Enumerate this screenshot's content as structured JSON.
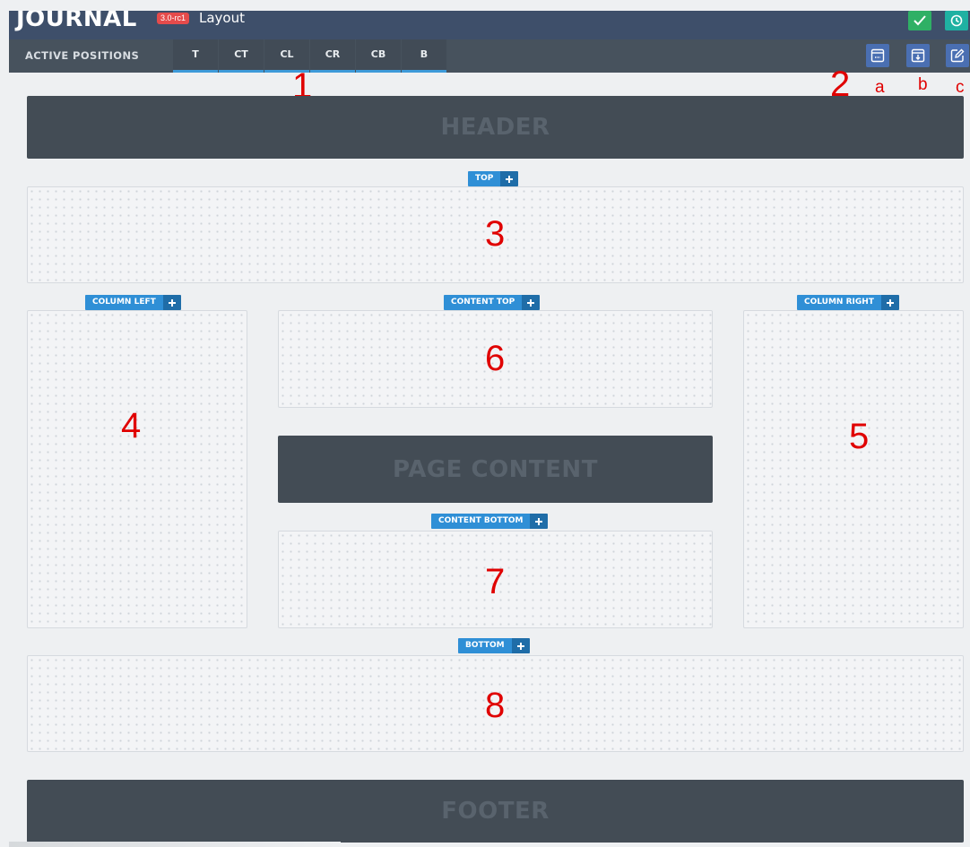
{
  "app": {
    "logo": "JOURNAL",
    "version": "3.0-rc1",
    "page_title": "Layout"
  },
  "top_buttons": [
    {
      "name": "save",
      "icon": "check-icon"
    },
    {
      "name": "history",
      "icon": "history-icon"
    }
  ],
  "positions_bar": {
    "label": "ACTIVE POSITIONS",
    "tabs": [
      "T",
      "CT",
      "CL",
      "CR",
      "CB",
      "B"
    ]
  },
  "tools": [
    {
      "icon": "layout-icon"
    },
    {
      "icon": "download-icon"
    },
    {
      "icon": "edit-icon"
    }
  ],
  "annotations": {
    "n1": "1",
    "n2": "2",
    "a": "a",
    "b": "b",
    "c": "c",
    "n3": "3",
    "n4": "4",
    "n5": "5",
    "n6": "6",
    "n7": "7",
    "n8": "8"
  },
  "blocks": {
    "header": "HEADER",
    "page_content": "PAGE CONTENT",
    "footer": "FOOTER"
  },
  "zones": {
    "top": "TOP",
    "column_left": "COLUMN LEFT",
    "content_top": "CONTENT TOP",
    "column_right": "COLUMN RIGHT",
    "content_bottom": "CONTENT BOTTOM",
    "bottom": "BOTTOM"
  },
  "colors": {
    "topbar": "#3e4f6a",
    "posbar": "#47525d",
    "tab_underline": "#3d9ad9",
    "tag": "#2f8fd6",
    "annotation": "#e00000",
    "save": "#2fb065",
    "history": "#1fb1a2"
  }
}
